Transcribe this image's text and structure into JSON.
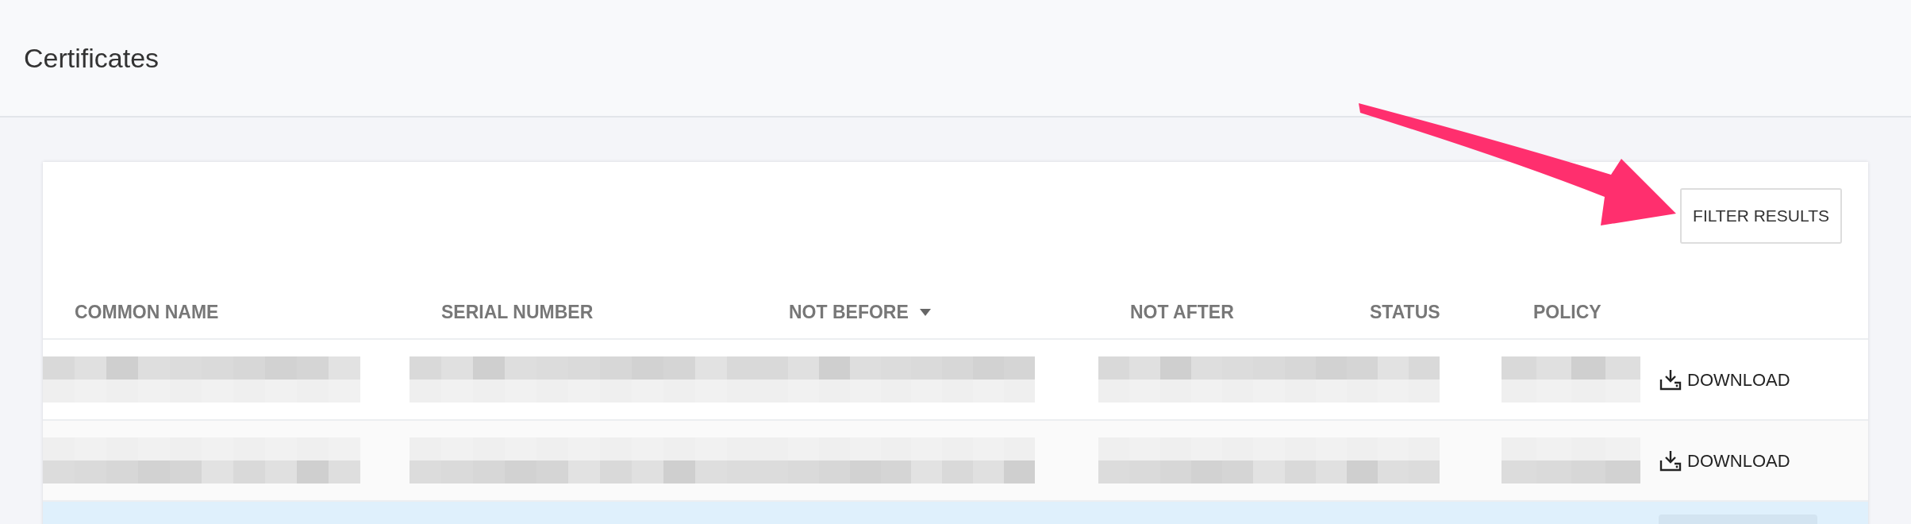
{
  "page": {
    "title": "Certificates"
  },
  "filter_button": {
    "label": "FILTER RESULTS"
  },
  "table": {
    "columns": [
      {
        "label": "COMMON NAME",
        "sorted": false
      },
      {
        "label": "SERIAL NUMBER",
        "sorted": false
      },
      {
        "label": "NOT BEFORE",
        "sorted": true
      },
      {
        "label": "NOT AFTER",
        "sorted": false
      },
      {
        "label": "STATUS",
        "sorted": false
      },
      {
        "label": "POLICY",
        "sorted": false
      }
    ],
    "rows": [
      {
        "highlighted": false,
        "action": "DOWNLOAD"
      },
      {
        "highlighted": false,
        "action": "DOWNLOAD"
      },
      {
        "highlighted": true
      }
    ]
  }
}
